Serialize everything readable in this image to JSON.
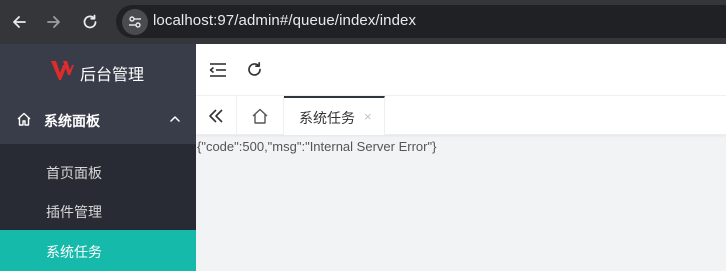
{
  "browser": {
    "url": "localhost:97/admin#/queue/index/index",
    "back_icon": "arrow-left-icon",
    "forward_icon": "arrow-right-icon",
    "reload_icon": "reload-icon",
    "site_info_icon": "site-info-icon"
  },
  "sidebar": {
    "logo_text": "后台管理",
    "logo_color": "#e02b2b",
    "menu_parent": {
      "label": "系统面板",
      "icon": "home-icon",
      "expanded": true
    },
    "items": [
      {
        "label": "首页面板",
        "active": false
      },
      {
        "label": "插件管理",
        "active": false
      },
      {
        "label": "系统任务",
        "active": true
      }
    ],
    "active_color": "#16baaa"
  },
  "header": {
    "menu_toggle_icon": "indent-icon",
    "refresh_icon": "refresh-icon"
  },
  "tabs": {
    "prev_icon": "double-left-icon",
    "home_icon": "home-icon",
    "active_tab": {
      "label": "系统任务",
      "close": "×"
    }
  },
  "content": {
    "response_text": "{\"code\":500,\"msg\":\"Internal Server Error\"}"
  }
}
